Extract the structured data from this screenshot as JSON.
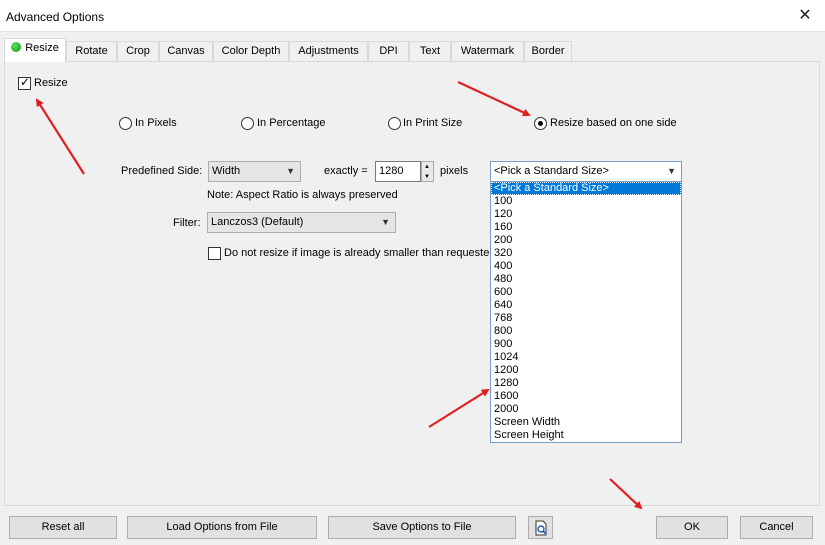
{
  "window": {
    "title": "Advanced Options",
    "close_glyph": "✕"
  },
  "tabs": [
    {
      "label": "Resize",
      "active": true
    },
    {
      "label": "Rotate"
    },
    {
      "label": "Crop"
    },
    {
      "label": "Canvas"
    },
    {
      "label": "Color Depth"
    },
    {
      "label": "Adjustments"
    },
    {
      "label": "DPI"
    },
    {
      "label": "Text"
    },
    {
      "label": "Watermark"
    },
    {
      "label": "Border"
    }
  ],
  "resize": {
    "enable_label": "Resize",
    "enable_checked": true,
    "modes": [
      {
        "label": "In Pixels",
        "selected": false
      },
      {
        "label": "In Percentage",
        "selected": false
      },
      {
        "label": "In Print Size",
        "selected": false
      },
      {
        "label": "Resize based on one side",
        "selected": true
      }
    ],
    "predefined_side_label": "Predefined Side:",
    "predefined_side_value": "Width",
    "exactly_label": "exactly =",
    "exactly_value": "1280",
    "pixels_label": "pixels",
    "aspect_note": "Note: Aspect Ratio is always preserved",
    "filter_label": "Filter:",
    "filter_value": "Lanczos3 (Default)",
    "no_upscale_label": "Do not resize if image is already smaller than requested",
    "no_upscale_checked": false,
    "standard_size_value": "<Pick a Standard Size>",
    "standard_sizes": [
      "<Pick a Standard Size>",
      "100",
      "120",
      "160",
      "200",
      "320",
      "400",
      "480",
      "600",
      "640",
      "768",
      "800",
      "900",
      "1024",
      "1200",
      "1280",
      "1600",
      "2000",
      "Screen Width",
      "Screen Height"
    ]
  },
  "buttons": {
    "reset": "Reset all",
    "load": "Load Options from File",
    "save": "Save Options to File",
    "ok": "OK",
    "cancel": "Cancel"
  },
  "icons": {
    "tab_status": "green-dot-icon",
    "close": "close-icon",
    "preview": "document-magnifier-icon",
    "annotation_arrow": "red-arrow-icon"
  },
  "colors": {
    "annotation_arrow": "#e02020",
    "list_selection": "#0078d7",
    "active_tab_dot": "#13a713"
  }
}
